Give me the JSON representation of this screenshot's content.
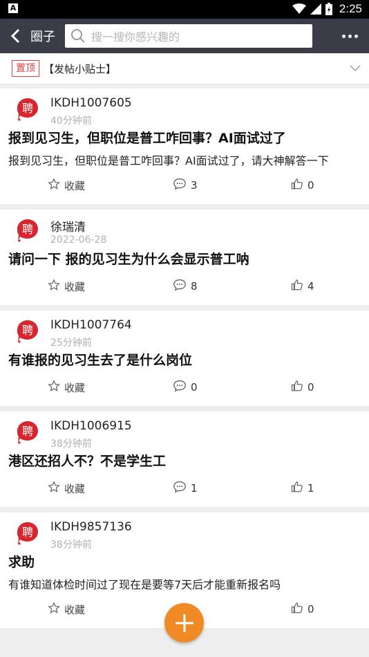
{
  "status": {
    "left_icon": "A",
    "time": "2:25"
  },
  "header": {
    "title": "圈子",
    "search_placeholder": "搜一搜你感兴趣的"
  },
  "pinned": {
    "badge": "置顶",
    "text": "【发帖小贴士】"
  },
  "avatar_char": "聘",
  "actions": {
    "favorite_label": "收藏"
  },
  "colors": {
    "accent": "#f08a24",
    "pin_red": "#e2403b",
    "avatar_red": "#d7262d"
  },
  "posts": [
    {
      "user": "IKDH1007605",
      "time": "40分钟前",
      "title": "报到见习生，但职位是普工咋回事？AI面试过了",
      "body": "报到见习生，但职位是普工咋回事？AI面试过了，请大神解答一下",
      "comments": "3",
      "likes": "0"
    },
    {
      "user": "徐瑞清",
      "time": "2022-06-28",
      "title": "请问一下 报的见习生为什么会显示普工呐",
      "body": "",
      "comments": "8",
      "likes": "4"
    },
    {
      "user": "IKDH1007764",
      "time": "25分钟前",
      "title": "有谁报的见习生去了是什么岗位",
      "body": "",
      "comments": "0",
      "likes": "0"
    },
    {
      "user": "IKDH1006915",
      "time": "38分钟前",
      "title": "港区还招人不？不是学生工",
      "body": "",
      "comments": "1",
      "likes": "1"
    },
    {
      "user": "IKDH9857136",
      "time": "38分钟前",
      "title": "求助",
      "body": "有谁知道体检时间过了现在是要等7天后才能重新报名吗",
      "comments": "",
      "likes": "0"
    }
  ]
}
